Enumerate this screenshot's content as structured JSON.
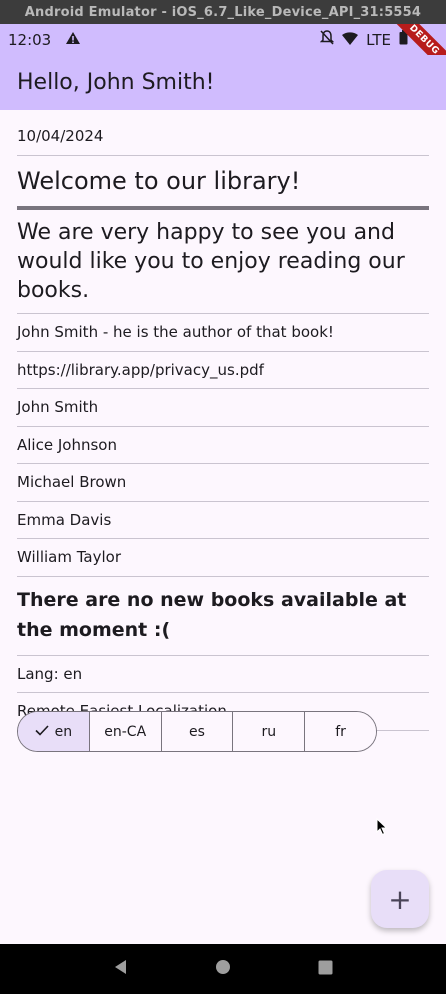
{
  "window": {
    "title": "Android Emulator - iOS_6.7_Like_Device_API_31:5554"
  },
  "status_bar": {
    "time": "12:03",
    "network": "LTE",
    "debug_banner": "DEBUG"
  },
  "app_bar": {
    "title": "Hello, John Smith!"
  },
  "content": {
    "date": "10/04/2024",
    "welcome": "Welcome to our library!",
    "happy": "We are very happy to see you and would like you to enjoy reading our books.",
    "author_note": "John Smith - he is the author of that book!",
    "privacy_url": "https://library.app/privacy_us.pdf",
    "authors": [
      "John Smith",
      "Alice Johnson",
      "Michael Brown",
      "Emma Davis",
      "William Taylor"
    ],
    "no_books": "There are no new books available at the moment :(",
    "lang_label": "Lang: en",
    "remote_label": "Remote Easiest Localization"
  },
  "language_selector": {
    "selected": "en",
    "options": [
      "en",
      "en-CA",
      "es",
      "ru",
      "fr"
    ]
  },
  "fab": {
    "icon": "plus-icon",
    "glyph": "+"
  },
  "colors": {
    "app_bar": "#d0bcfe",
    "background": "#fdf7fe",
    "selected_segment": "#e8def8",
    "divider": "#cac4d0"
  }
}
